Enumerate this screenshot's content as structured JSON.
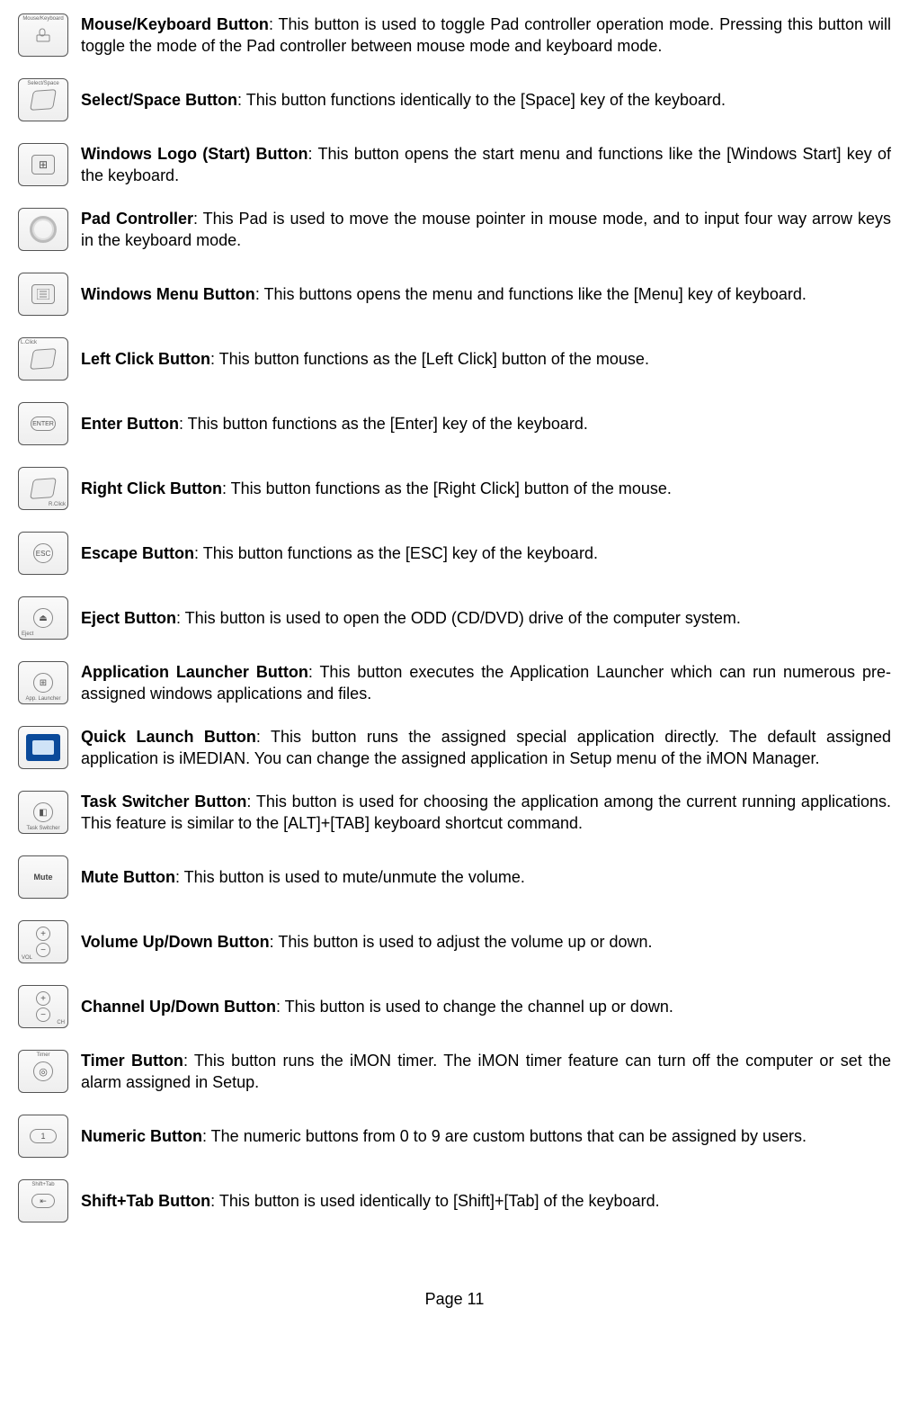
{
  "footer": "Page 11",
  "items": [
    {
      "id": "mouse-keyboard",
      "name": "Mouse/Keyboard Button",
      "text": ": This button is used to toggle Pad controller operation mode. Pressing this button will toggle the mode of the Pad controller between mouse mode and keyboard mode.",
      "icon_label_top": "Mouse/Keyboard"
    },
    {
      "id": "select-space",
      "name": "Select/Space Button",
      "text": ": This button functions identically to the [Space] key of the keyboard.",
      "icon_label_top": "Select/Space"
    },
    {
      "id": "windows-start",
      "name": "Windows Logo (Start) Button",
      "text": ": This button opens the start menu and functions like the [Windows Start] key of the keyboard."
    },
    {
      "id": "pad-controller",
      "name": "Pad Controller",
      "text": ": This Pad is used to move the mouse pointer in mouse mode, and to input four way arrow keys in the keyboard mode."
    },
    {
      "id": "windows-menu",
      "name": "Windows Menu Button",
      "text": ": This buttons opens the menu and functions like the [Menu] key of keyboard."
    },
    {
      "id": "left-click",
      "name": "Left Click Button",
      "text": ": This button functions as the [Left Click] button of the mouse.",
      "icon_label_top": "L.Click"
    },
    {
      "id": "enter",
      "name": "Enter Button",
      "text": ": This button functions as the [Enter] key of the keyboard.",
      "icon_center": "ENTER"
    },
    {
      "id": "right-click",
      "name": "Right Click Button",
      "text": ": This button functions as the [Right Click] button of the mouse.",
      "icon_label_bot": "R.Click"
    },
    {
      "id": "escape",
      "name": "Escape Button",
      "text": ": This button functions as the [ESC] key of the keyboard.",
      "icon_center": "ESC"
    },
    {
      "id": "eject",
      "name": "Eject Button",
      "text": ": This button is used to open the ODD (CD/DVD) drive of the computer system.",
      "icon_label_bot": "Eject",
      "icon_glyph": "⏏"
    },
    {
      "id": "app-launcher",
      "name": "Application Launcher Button",
      "text": ": This button executes the Application Launcher which can run numerous pre-assigned windows applications and files.",
      "icon_label_bot": "App. Launcher",
      "icon_glyph": "⊞"
    },
    {
      "id": "quick-launch",
      "name": "Quick Launch Button",
      "text": ": This button runs the assigned special application directly. The default assigned application is iMEDIAN. You can change the assigned application in Setup menu of the iMON Manager."
    },
    {
      "id": "task-switcher",
      "name": "Task Switcher Button",
      "text": ": This button is used for choosing the application among the current running applications. This feature is similar to the [ALT]+[TAB] keyboard shortcut command.",
      "icon_label_bot": "Task Switcher",
      "icon_glyph": "◧"
    },
    {
      "id": "mute",
      "name": "Mute Button",
      "text": ": This button is used to mute/unmute the volume.",
      "icon_center": "Mute"
    },
    {
      "id": "volume",
      "name": "Volume Up/Down Button",
      "text": ": This button is used to adjust the volume up or down.",
      "icon_label_bot": "VOL"
    },
    {
      "id": "channel",
      "name": "Channel Up/Down Button",
      "text": ": This button is used to change the channel up or down.",
      "icon_label_bot": "CH"
    },
    {
      "id": "timer",
      "name": "Timer Button",
      "text": ": This button runs the iMON timer. The iMON timer feature can turn off the computer or set the alarm assigned in Setup.",
      "icon_label_top": "Timer",
      "icon_glyph": "◎"
    },
    {
      "id": "numeric",
      "name": "Numeric Button",
      "text": ": The numeric buttons from 0 to 9 are custom buttons that can be assigned by users.",
      "icon_center": "1"
    },
    {
      "id": "shift-tab",
      "name": "Shift+Tab Button",
      "text": ": This button is used identically to [Shift]+[Tab] of the keyboard.",
      "icon_label_top": "Shift+Tab",
      "icon_glyph": "⇤"
    }
  ]
}
